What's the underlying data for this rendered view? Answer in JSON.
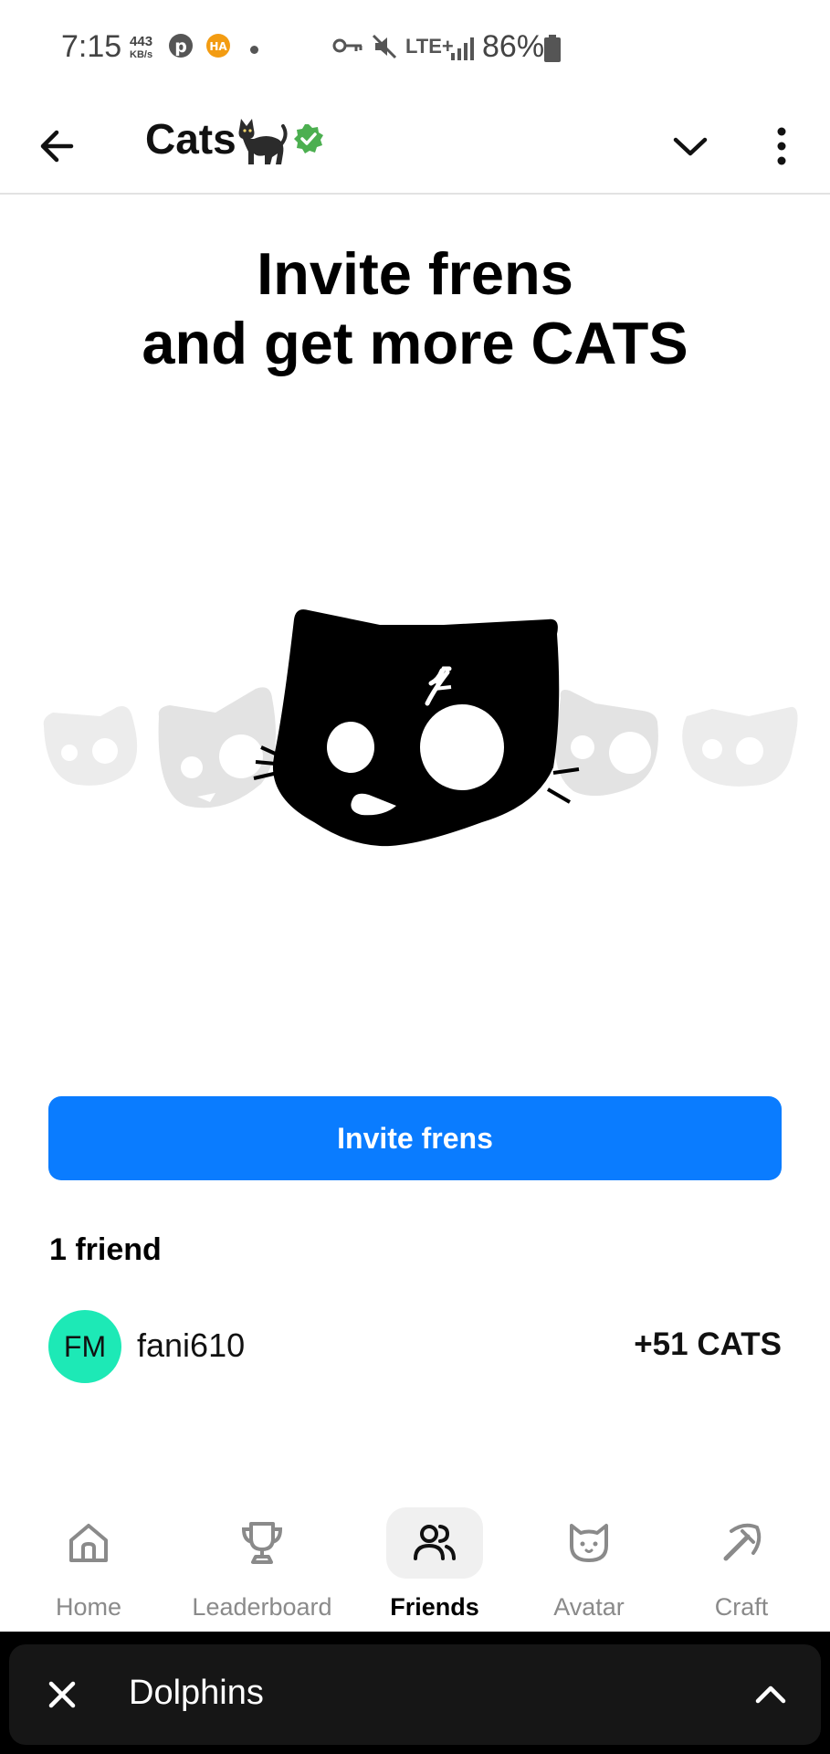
{
  "status_bar": {
    "time": "7:15",
    "data_rate_value": "443",
    "data_rate_unit": "KB/s",
    "network": "LTE+",
    "battery": "86%"
  },
  "header": {
    "title": "Cats"
  },
  "hero": {
    "headline_line1": "Invite frens",
    "headline_line2": "and get more CATS"
  },
  "invite": {
    "button_label": "Invite frens"
  },
  "friends": {
    "count_label": "1 friend",
    "list": [
      {
        "initials": "FM",
        "name": "fani610",
        "reward": "+51 CATS",
        "avatar_color": "#1de9b6"
      }
    ]
  },
  "nav": {
    "items": [
      {
        "label": "Home",
        "icon": "home-icon"
      },
      {
        "label": "Leaderboard",
        "icon": "trophy-icon"
      },
      {
        "label": "Friends",
        "icon": "friends-icon",
        "active": true
      },
      {
        "label": "Avatar",
        "icon": "cat-face-icon"
      },
      {
        "label": "Craft",
        "icon": "pickaxe-icon"
      }
    ]
  },
  "mini_app_bar": {
    "title": "Dolphins"
  },
  "colors": {
    "accent": "#0a7cff",
    "avatar": "#1de9b6",
    "verified": "#4caf50"
  }
}
